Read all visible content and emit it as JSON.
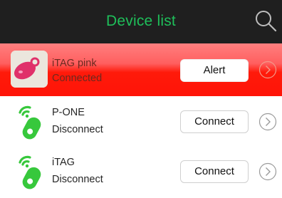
{
  "header": {
    "title": "Device list",
    "title_color": "#1fbf5a",
    "background": "#1f1f1f",
    "search_icon": "search-icon"
  },
  "devices": [
    {
      "name": "iTAG pink",
      "status": "Connected",
      "action": "Alert",
      "icon": "pink-tag-photo",
      "highlight_color": "#ff1a0a"
    },
    {
      "name": "P-ONE",
      "status": "Disconnect",
      "action": "Connect",
      "icon": "green-tag-signal-icon"
    },
    {
      "name": "iTAG",
      "status": "Disconnect",
      "action": "Connect",
      "icon": "green-tag-signal-icon"
    }
  ],
  "accent_green": "#37c83c"
}
